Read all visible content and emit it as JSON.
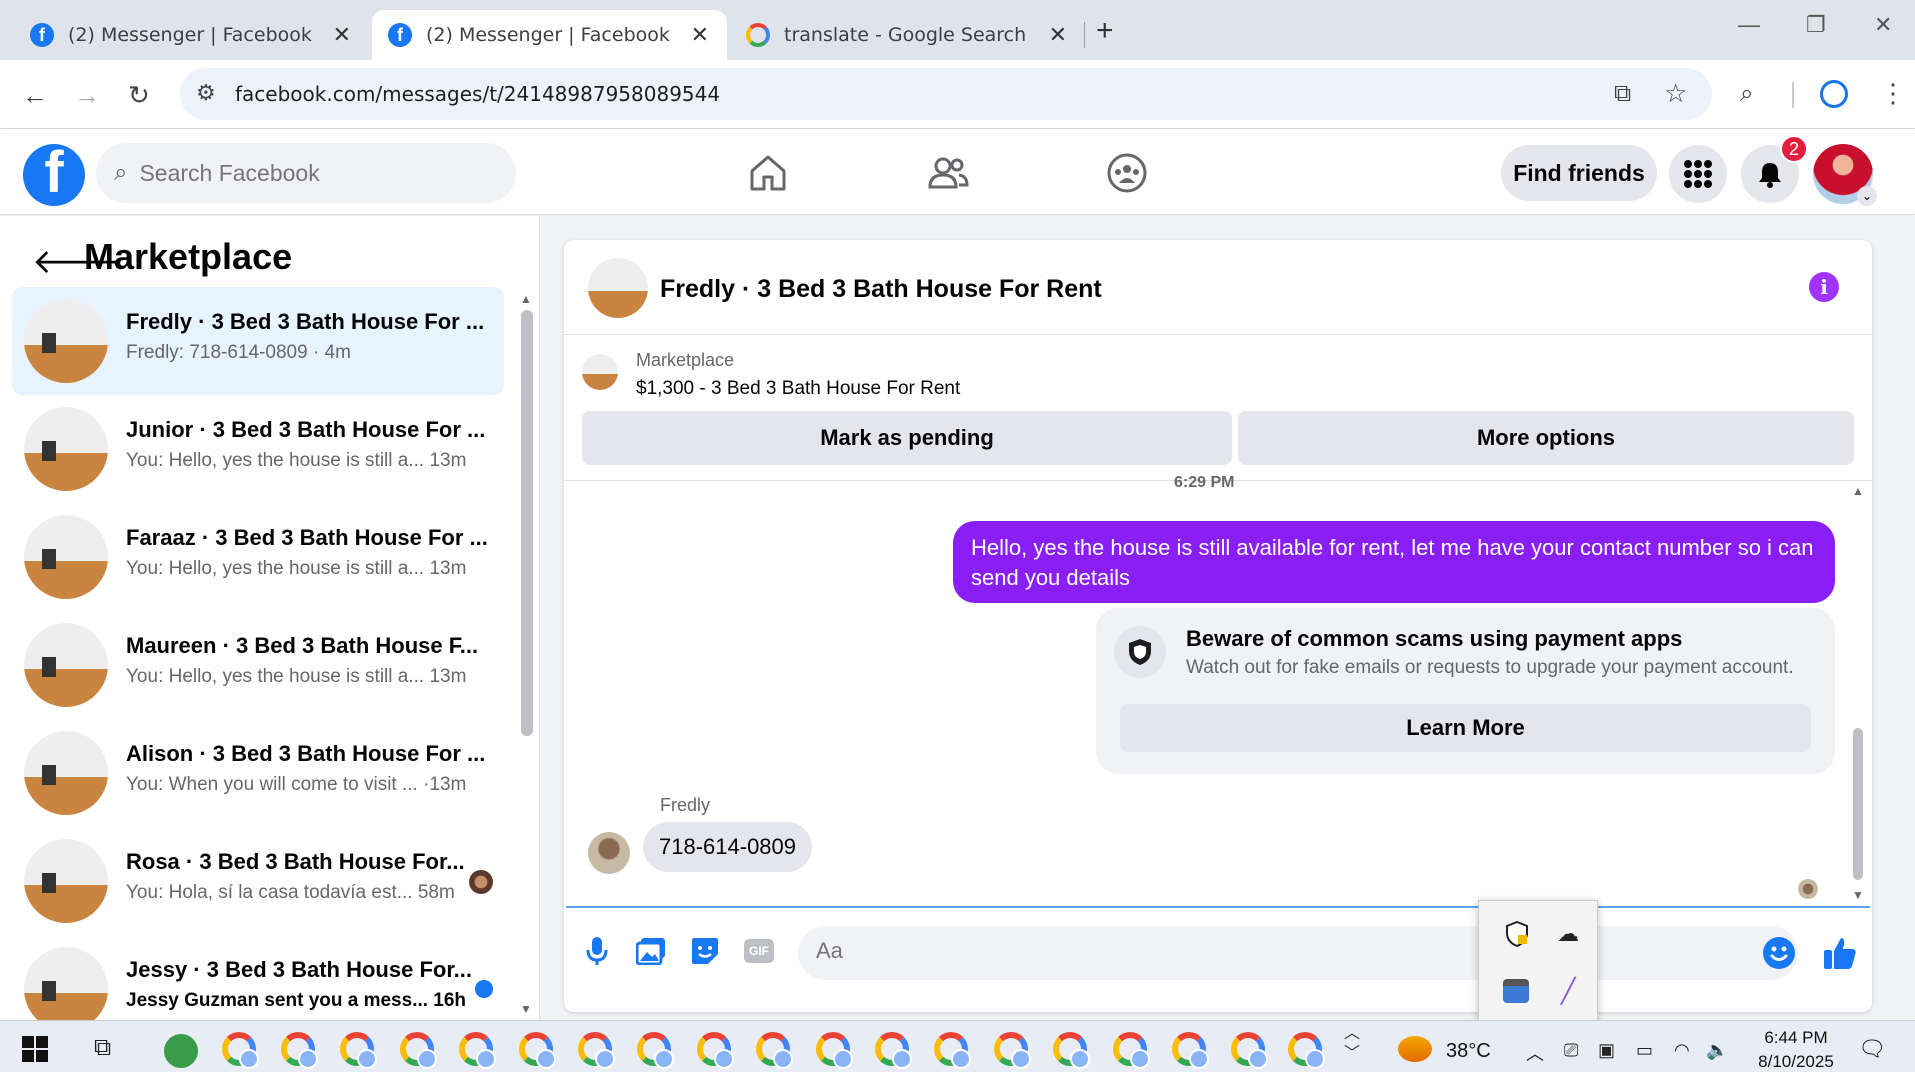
{
  "browser": {
    "tabs": [
      {
        "title": "(2) Messenger | Facebook",
        "icon": "facebook-icon"
      },
      {
        "title": "(2) Messenger | Facebook",
        "icon": "facebook-icon",
        "active": true
      },
      {
        "title": "translate - Google Search",
        "icon": "google-icon"
      }
    ],
    "url": "facebook.com/messages/t/24148987958089544"
  },
  "fb_header": {
    "logo": "f",
    "search_placeholder": "Search Facebook",
    "find_friends": "Find friends",
    "notification_count": "2"
  },
  "sidebar": {
    "title": "Marketplace",
    "conversations": [
      {
        "name": "Fredly · 3 Bed 3 Bath House For ...",
        "preview": "Fredly: 718-614-0809 · 4m",
        "selected": true
      },
      {
        "name": "Junior · 3 Bed 3 Bath House For ...",
        "preview": "You: Hello, yes the house is still a...   13m"
      },
      {
        "name": "Faraaz · 3 Bed 3 Bath House For ...",
        "preview": "You: Hello, yes the house is still a...   13m"
      },
      {
        "name": "Maureen · 3 Bed 3 Bath House F...",
        "preview": "You: Hello, yes the house is still a...   13m"
      },
      {
        "name": "Alison · 3 Bed 3 Bath House For ...",
        "preview": "You: When you will come to visit ... ·13m"
      },
      {
        "name": "Rosa · 3 Bed 3 Bath House For...",
        "preview": "You: Hola, sí la casa todavía est...  58m"
      },
      {
        "name": "Jessy · 3 Bed 3 Bath House For...",
        "preview": "Jessy Guzman sent you a mess...  16h",
        "unread": true
      }
    ]
  },
  "chat": {
    "title": "Fredly · 3 Bed 3 Bath House For Rent",
    "listing_category": "Marketplace",
    "listing_title": "$1,300 - 3 Bed 3 Bath House For Rent",
    "mark_pending": "Mark as pending",
    "more_options": "More options",
    "timestamp": "6:29 PM",
    "outgoing_message": "Hello, yes the house is still available for rent, let me have your contact number so i can send you  details",
    "scam_title": "Beware of common scams using payment apps",
    "scam_body": "Watch out for fake emails or requests to upgrade your payment account.",
    "learn_more": "Learn More",
    "sender_name": "Fredly",
    "incoming_message": "718-614-0809",
    "composer_placeholder": "Aa"
  },
  "taskbar": {
    "temperature": "38°C",
    "time": "6:44 PM",
    "date": "8/10/2025"
  },
  "colors": {
    "fb_blue": "#1877f2",
    "bubble_purple": "#8a1ff5",
    "selected_bg": "#e7f3ff"
  }
}
